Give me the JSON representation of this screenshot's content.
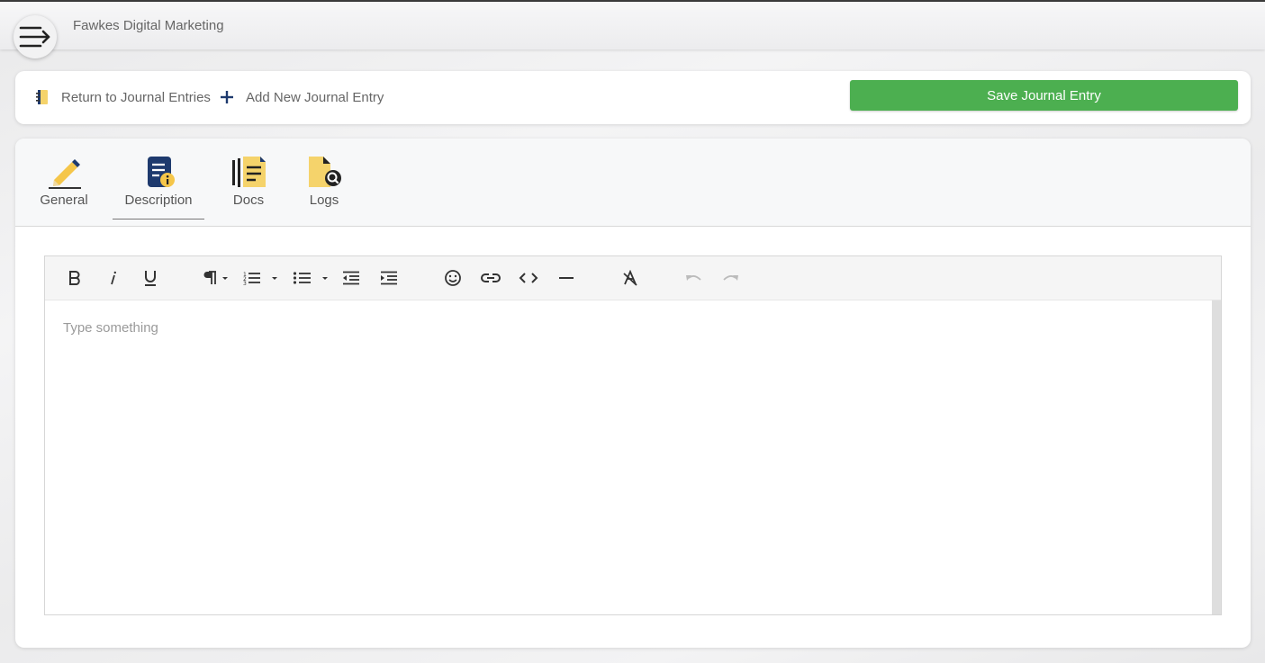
{
  "header": {
    "company": "Fawkes Digital Marketing",
    "menu_icon": "menu-arrow-icon"
  },
  "actions": {
    "return_label": "Return to Journal Entries",
    "add_label": "Add New Journal Entry",
    "save_label": "Save Journal Entry",
    "save_color": "#4caf50"
  },
  "tabs": [
    {
      "label": "General",
      "icon": "pencil-icon"
    },
    {
      "label": "Description",
      "icon": "document-info-icon"
    },
    {
      "label": "Docs",
      "icon": "docs-icon"
    },
    {
      "label": "Logs",
      "icon": "logs-search-icon"
    }
  ],
  "active_tab": "Description",
  "editor": {
    "placeholder": "Type something",
    "toolbar": [
      "bold",
      "italic",
      "underline",
      "paragraph-format",
      "ordered-list",
      "unordered-list",
      "outdent",
      "indent",
      "emoticons",
      "link",
      "code-view",
      "horizontal-line",
      "clear-formatting",
      "undo",
      "redo"
    ]
  }
}
